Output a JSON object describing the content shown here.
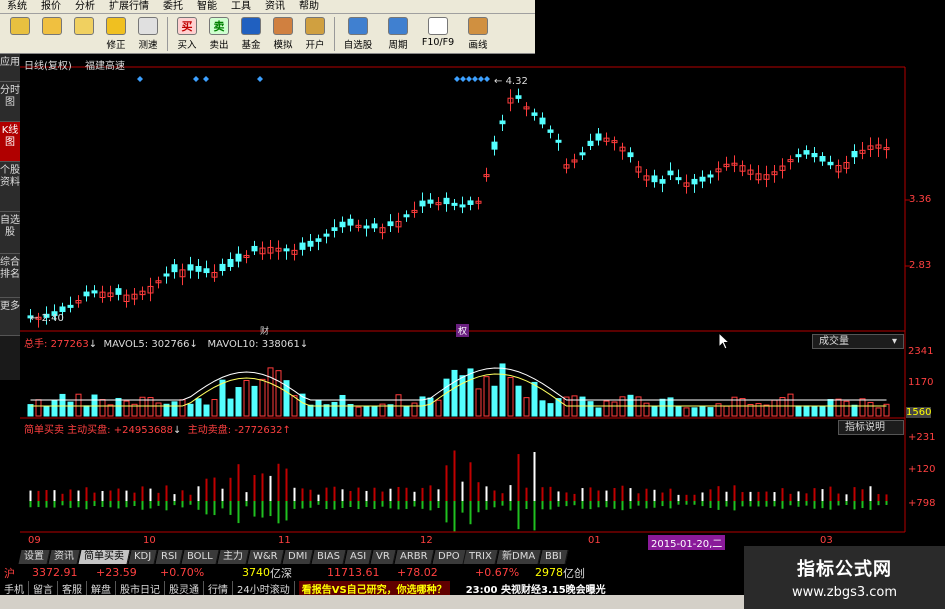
{
  "menu": [
    "系统",
    "报价",
    "分析",
    "扩展行情",
    "委托",
    "智能",
    "工具",
    "资讯",
    "帮助"
  ],
  "toolbar": [
    {
      "label": "",
      "icon": "grid-icon"
    },
    {
      "label": "",
      "icon": "back-arrow-icon"
    },
    {
      "label": "",
      "icon": "up-down-icon"
    },
    {
      "label": "修正",
      "icon": "fix-icon"
    },
    {
      "label": "测速",
      "icon": "speed-icon"
    },
    {
      "label": "买入",
      "icon": "buy-icon",
      "glyph": "买"
    },
    {
      "label": "卖出",
      "icon": "sell-icon",
      "glyph": "卖"
    },
    {
      "label": "基金",
      "icon": "fund-icon"
    },
    {
      "label": "模拟",
      "icon": "simulate-icon"
    },
    {
      "label": "开户",
      "icon": "lock-icon"
    },
    {
      "label": "自选股",
      "icon": "watchlist-icon"
    },
    {
      "label": "周期",
      "icon": "clock-icon"
    },
    {
      "label": "F10/F9",
      "icon": "f10-icon"
    },
    {
      "label": "画线",
      "icon": "draw-icon"
    }
  ],
  "sidetabs": [
    {
      "label": "应用",
      "active": false
    },
    {
      "label": "分时图",
      "active": false
    },
    {
      "label": "K线图",
      "active": true
    },
    {
      "label": "个股资料",
      "active": false
    },
    {
      "label": "自选股",
      "active": false
    },
    {
      "label": "综合排名",
      "active": false
    },
    {
      "label": "更多",
      "active": false
    }
  ],
  "chart_header": {
    "period": "日线(复权)",
    "name": "福建高速"
  },
  "price_axis": [
    "3.36",
    "2.83"
  ],
  "annotations": {
    "high_price": "4.32",
    "low_price": "2.40",
    "marker_a": "财",
    "marker_b": "权"
  },
  "volume_panel": {
    "total_label": "总手:",
    "total_value": "277263",
    "mavol5_label": "MAVOL5:",
    "mavol5_value": "302766",
    "mavol10_label": "MAVOL10:",
    "mavol10_value": "338061",
    "selector": "成交量",
    "axis": [
      "2341",
      "1170",
      "1560"
    ]
  },
  "flow_panel": {
    "title": "简单买卖",
    "buy_label": "主动买盘:",
    "buy_value": "+24953688",
    "sell_label": "主动卖盘:",
    "sell_value": "-2772632",
    "help_button": "指标说明",
    "axis": [
      "+231",
      "+120",
      "+798"
    ]
  },
  "x_axis": [
    "09",
    "10",
    "11",
    "12",
    "01",
    "03"
  ],
  "date_badge": "2015-01-20,二",
  "indicator_tabs": [
    "设置",
    "资讯",
    "简单买卖",
    "KDJ",
    "RSI",
    "BOLL",
    "主力",
    "W&R",
    "DMI",
    "BIAS",
    "ASI",
    "VR",
    "ARBR",
    "DPO",
    "TRIX",
    "新DMA",
    "BBI"
  ],
  "active_indicator": "简单买卖",
  "ticker": {
    "sh_label": "沪",
    "sh_index": "3372.91",
    "sh_change": "+23.59",
    "sh_pct": "+0.70%",
    "sh_amount": "3740",
    "sh_unit": "亿",
    "sz_label": "深",
    "sz_index": "11713.61",
    "sz_change": "+78.02",
    "sz_pct": "+0.67%",
    "sz_amount": "2978",
    "sz_unit": "亿",
    "cy_label": "创"
  },
  "ticker_links": [
    "手机",
    "留言",
    "客服",
    "解盘",
    "股市日记",
    "股灵通",
    "行情",
    "24小时滚动"
  ],
  "news": {
    "headline": "看报告VS自己研究，你选哪种？",
    "time_news": "23:00 央视财经3.15晚会曝光"
  },
  "watermark": {
    "title": "指标公式网",
    "url": "www.zbgs3.com"
  },
  "colors": {
    "up": "#ff3c3c",
    "down": "#54ffff",
    "axis": "#b40000",
    "text_red": "#ff4040",
    "text_yellow": "#ffff00"
  }
}
